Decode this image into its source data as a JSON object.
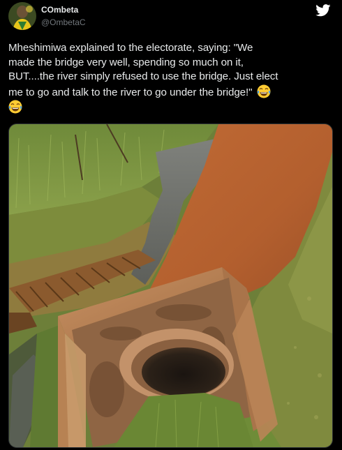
{
  "tweet": {
    "display_name": "COmbeta",
    "handle": "@OmbetaC",
    "text_line_1": "Mheshimiwa explained to the electorate, saying: \"We",
    "text_line_2": "made the bridge very well, spending so much on it,",
    "text_line_3": "BUT....the river simply refused to use the bridge. Just elect",
    "text_line_4": "me to go and talk to the river to go under the bridge!\"",
    "emoji_1": "face-with-tears-of-joy",
    "emoji_2": "face-with-tears-of-joy"
  },
  "icons": {
    "platform": "twitter-bird-icon",
    "bird_color": "#ffffff"
  },
  "media": {
    "description_colors": {
      "soil": "#b5652f",
      "grass": "#5f7d2f",
      "water": "#6b6d69",
      "concrete": "#b07a4c"
    }
  }
}
